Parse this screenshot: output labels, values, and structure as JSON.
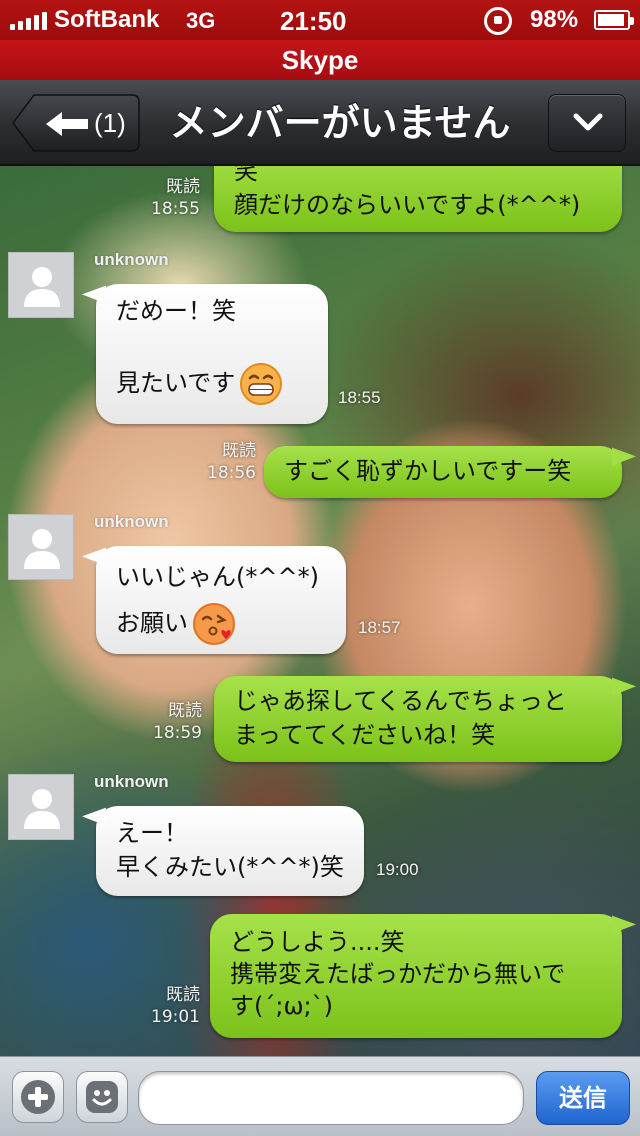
{
  "status_bar": {
    "carrier": "SoftBank",
    "network": "3G",
    "time": "21:50",
    "battery": "98%",
    "icons": [
      "signal-icon",
      "rotation-lock-icon",
      "battery-icon"
    ]
  },
  "app_title": "Skype",
  "nav": {
    "back_count": "(1)",
    "title": "メンバーがいません",
    "back_icon": "back-arrow-icon",
    "menu_icon": "chevron-down-icon"
  },
  "messages": [
    {
      "from": "me",
      "lines": [
        "笑",
        "顔だけのならいいですよ(*^^*)"
      ],
      "status": "既読",
      "time": "18:55"
    },
    {
      "from": "unknown",
      "sender": "unknown",
      "lines": [
        "だめー！笑",
        "",
        "見たいです"
      ],
      "emoji": "grinning-emoji",
      "time": "18:55"
    },
    {
      "from": "me",
      "lines": [
        "すごく恥ずかしいですー笑"
      ],
      "status": "既読",
      "time": "18:56"
    },
    {
      "from": "unknown",
      "sender": "unknown",
      "lines": [
        "いいじゃん(*^^*)",
        "お願い"
      ],
      "emoji": "kissing-emoji",
      "time": "18:57"
    },
    {
      "from": "me",
      "lines": [
        "じゃあ探してくるんでちょっと",
        "まっててくださいね！笑"
      ],
      "status": "既読",
      "time": "18:59"
    },
    {
      "from": "unknown",
      "sender": "unknown",
      "lines": [
        "えー！",
        "早くみたい(*^^*)笑"
      ],
      "time": "19:00"
    },
    {
      "from": "me",
      "lines": [
        "どうしよう....笑",
        "携帯変えたばっかだから無いで",
        "す(´;ω;`)"
      ],
      "status": "既読",
      "time": "19:01"
    }
  ],
  "input_bar": {
    "plus_icon": "plus-icon",
    "smile_icon": "smiley-icon",
    "text_value": "",
    "send_label": "送信"
  },
  "colors": {
    "status_bar": "#a80f0f",
    "outgoing_bubble": "#8fd233",
    "incoming_bubble": "#ffffff",
    "send_button": "#2f76dc"
  }
}
